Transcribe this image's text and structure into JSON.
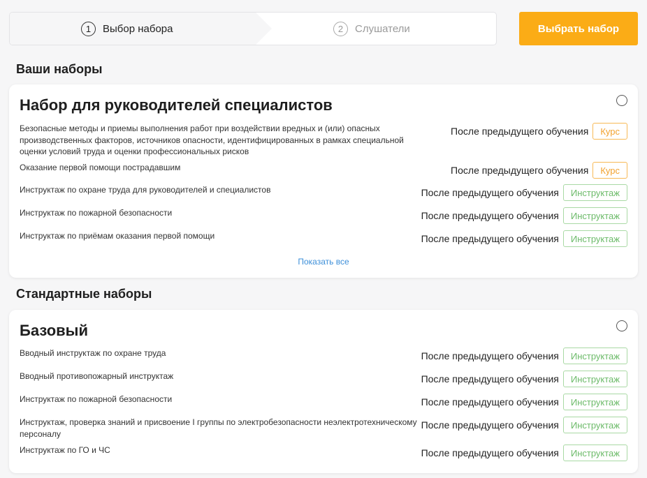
{
  "stepper": {
    "step1": {
      "num": "1",
      "label": "Выбор набора"
    },
    "step2": {
      "num": "2",
      "label": "Слушатели"
    }
  },
  "cta_label": "Выбрать набор",
  "sections": {
    "yours_title": "Ваши наборы",
    "standard_title": "Стандартные наборы"
  },
  "set1": {
    "title": "Набор для руководителей специалистов",
    "rows": [
      {
        "name": "Безопасные методы и приемы выполнения работ при воздействии вредных и (или) опасных производственных факторов, источников опасности, идентифицированных в рамках специальной оценки условий труда и оценки профессиональных рисков",
        "when": "После предыдущего обучения",
        "type": "Курс"
      },
      {
        "name": "Оказание первой помощи пострадавшим",
        "when": "После предыдущего обучения",
        "type": "Курс"
      },
      {
        "name": "Инструктаж по охране труда для руководителей и специалистов",
        "when": "После предыдущего обучения",
        "type": "Инструктаж"
      },
      {
        "name": "Инструктаж по пожарной безопасности",
        "when": "После предыдущего обучения",
        "type": "Инструктаж"
      },
      {
        "name": "Инструктаж по приёмам оказания первой помощи",
        "when": "После предыдущего обучения",
        "type": "Инструктаж"
      }
    ],
    "show_all": "Показать все"
  },
  "set2": {
    "title": "Базовый",
    "rows": [
      {
        "name": "Вводный инструктаж по охране труда",
        "when": "После предыдущего обучения",
        "type": "Инструктаж"
      },
      {
        "name": "Вводный противопожарный инструктаж",
        "when": "После предыдущего обучения",
        "type": "Инструктаж"
      },
      {
        "name": "Инструктаж по пожарной безопасности",
        "when": "После предыдущего обучения",
        "type": "Инструктаж"
      },
      {
        "name": "Инструктаж, проверка знаний и присвоение I группы по электробезопасности неэлектротехническому персоналу",
        "when": "После предыдущего обучения",
        "type": "Инструктаж"
      },
      {
        "name": "Инструктаж по ГО и ЧС",
        "when": "После предыдущего обучения",
        "type": "Инструктаж"
      }
    ]
  },
  "colors": {
    "accent": "#fbac16",
    "course_badge": "#f2a22f",
    "briefing_badge": "#6dbb6a",
    "link": "#3d8fd9"
  }
}
